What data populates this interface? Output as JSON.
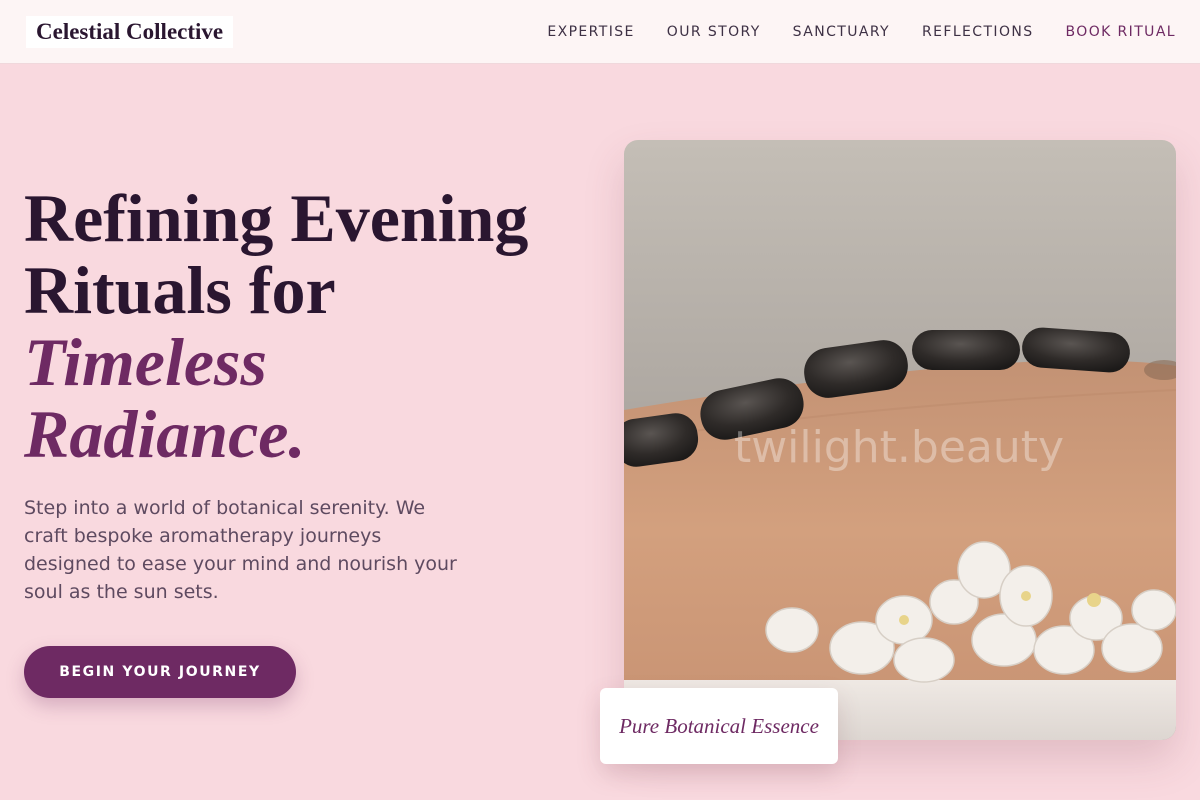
{
  "header": {
    "brand": "Celestial Collective",
    "nav": [
      "EXPERTISE",
      "OUR STORY",
      "SANCTUARY",
      "REFLECTIONS",
      "BOOK RITUAL"
    ]
  },
  "hero": {
    "title_line1": "Refining Evening",
    "title_line2": "Rituals for",
    "title_accent1": "Timeless",
    "title_accent2": "Radiance",
    "title_dot": ".",
    "copy": "Step into a world of botanical serenity. We craft bespoke aromatherapy journeys designed to ease your mind and nourish your soul as the sun sets.",
    "cta": "BEGIN YOUR JOURNEY"
  },
  "photo": {
    "watermark": "twilight.beauty",
    "caption": "Pure Botanical Essence"
  },
  "colors": {
    "background": "#f9d9df",
    "header_bg": "#fdf5f5",
    "heading": "#2a1630",
    "accent": "#6e2a63",
    "body_text": "#5e4a60"
  }
}
